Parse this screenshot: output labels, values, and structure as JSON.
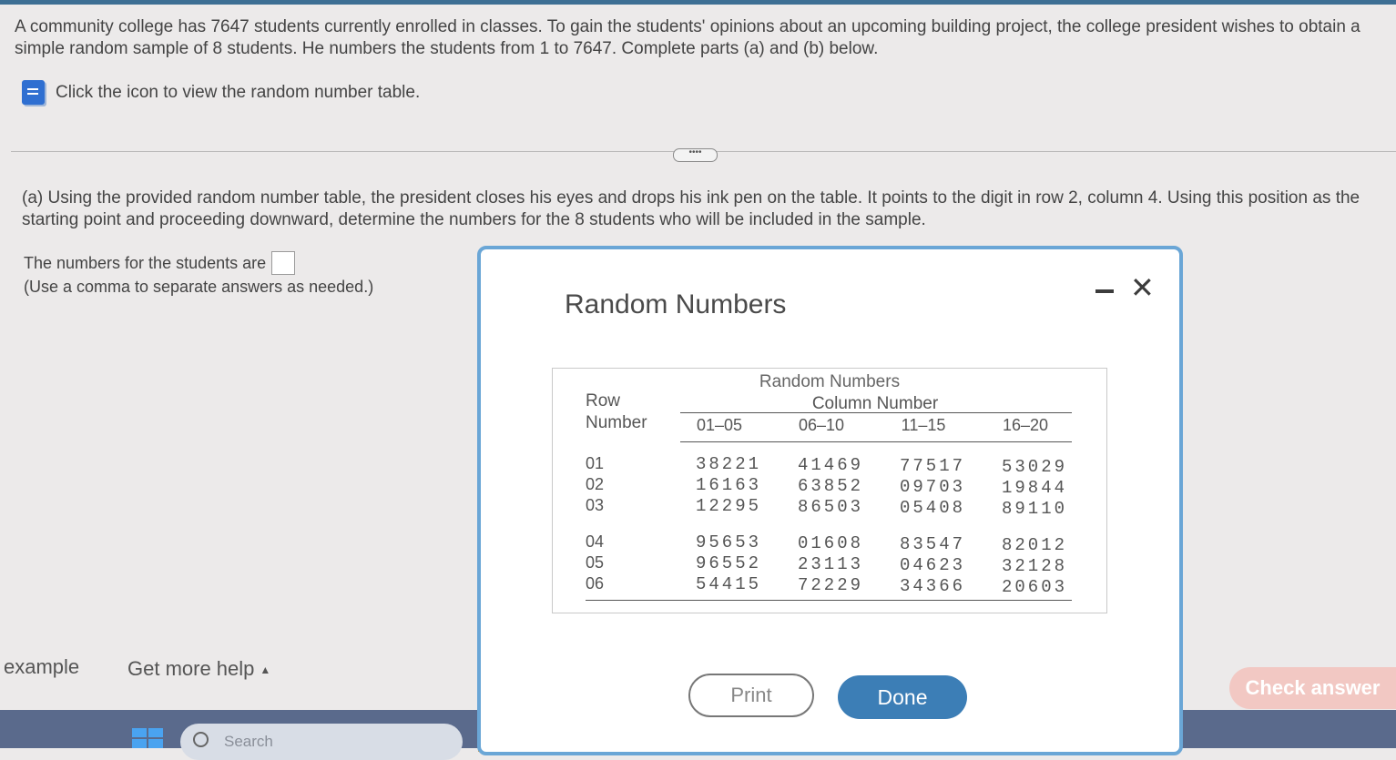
{
  "problem": {
    "statement": "A community college has 7647 students currently enrolled in classes. To gain the students' opinions about an upcoming building project, the college president wishes to obtain a simple random sample of 8 students. He numbers the students from 1 to 7647. Complete parts (a) and (b) below.",
    "icon_link": "Click the icon to view the random number table.",
    "expander_label": "••••"
  },
  "part_a": {
    "text": "(a) Using the provided random number table, the president closes his eyes and drops his ink pen on the table. It points to the digit in row 2, column 4. Using this position as the starting point and proceeding downward, determine the numbers for the 8 students who will be included in the sample.",
    "answer_label": "The numbers for the students are",
    "answer_value": "",
    "note": "(Use a comma to separate answers as needed.)"
  },
  "footer": {
    "example": "example",
    "help": "Get more help",
    "help_caret": "▲",
    "check_answer": "Check answer"
  },
  "taskbar": {
    "search_placeholder": "Search",
    "icon_colors": [
      "#e6a43a",
      "#f07a2c",
      "#5fb0e8",
      "#2fa6d6",
      "#f4c33d",
      "#3c86e0",
      "#d9463e",
      "#7f5fc2",
      "#49b05c"
    ]
  },
  "dialog": {
    "title": "Random Numbers",
    "minimize": "–",
    "close": "✕",
    "table": {
      "caption": "Random Numbers",
      "subcaption": "Column Number",
      "row_header_line1": "Row",
      "row_header_line2": "Number",
      "columns": [
        "01–05",
        "06–10",
        "11–15",
        "16–20"
      ],
      "rows": [
        {
          "num": "01",
          "values": [
            "38221",
            "41469",
            "77517",
            "53029"
          ]
        },
        {
          "num": "02",
          "values": [
            "16163",
            "63852",
            "09703",
            "19844"
          ]
        },
        {
          "num": "03",
          "values": [
            "12295",
            "86503",
            "05408",
            "89110"
          ]
        },
        {
          "num": "04",
          "values": [
            "95653",
            "01608",
            "83547",
            "82012"
          ]
        },
        {
          "num": "05",
          "values": [
            "96552",
            "23113",
            "04623",
            "32128"
          ]
        },
        {
          "num": "06",
          "values": [
            "54415",
            "72229",
            "34366",
            "20603"
          ]
        }
      ]
    },
    "print_label": "Print",
    "done_label": "Done"
  }
}
